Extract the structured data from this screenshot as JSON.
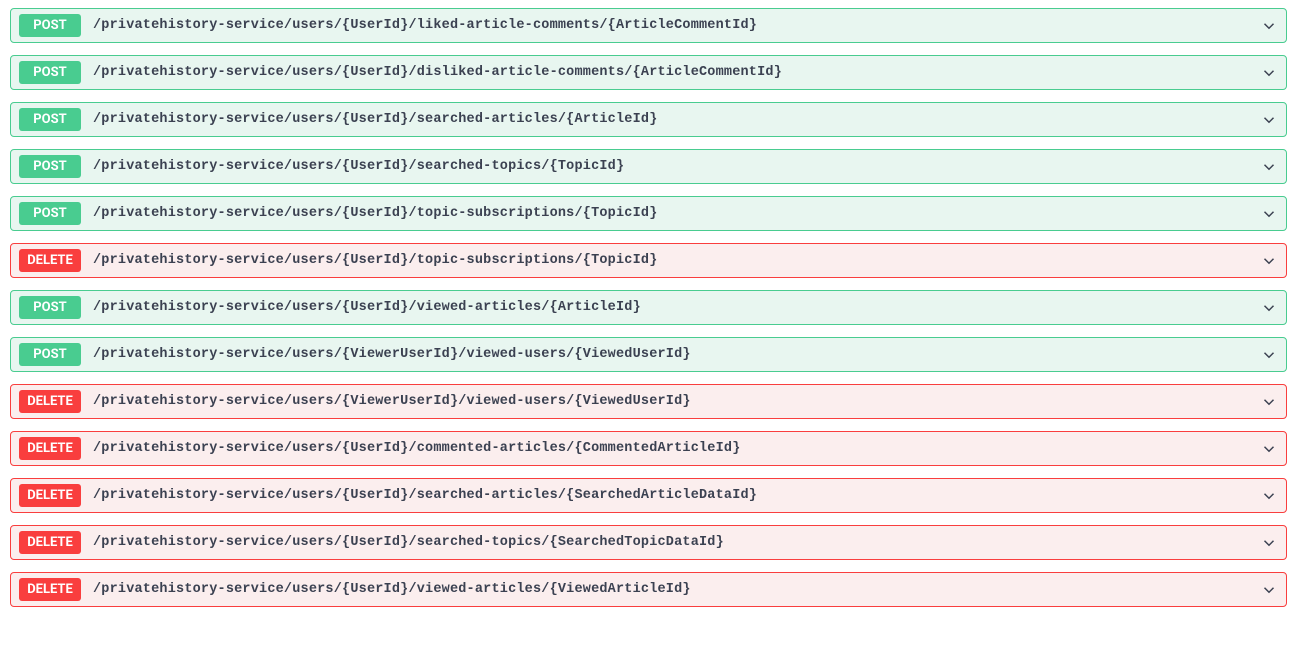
{
  "endpoints": [
    {
      "method": "POST",
      "path": "/privatehistory-service/users/{UserId}/liked-article-comments/{ArticleCommentId}"
    },
    {
      "method": "POST",
      "path": "/privatehistory-service/users/{UserId}/disliked-article-comments/{ArticleCommentId}"
    },
    {
      "method": "POST",
      "path": "/privatehistory-service/users/{UserId}/searched-articles/{ArticleId}"
    },
    {
      "method": "POST",
      "path": "/privatehistory-service/users/{UserId}/searched-topics/{TopicId}"
    },
    {
      "method": "POST",
      "path": "/privatehistory-service/users/{UserId}/topic-subscriptions/{TopicId}"
    },
    {
      "method": "DELETE",
      "path": "/privatehistory-service/users/{UserId}/topic-subscriptions/{TopicId}"
    },
    {
      "method": "POST",
      "path": "/privatehistory-service/users/{UserId}/viewed-articles/{ArticleId}"
    },
    {
      "method": "POST",
      "path": "/privatehistory-service/users/{ViewerUserId}/viewed-users/{ViewedUserId}"
    },
    {
      "method": "DELETE",
      "path": "/privatehistory-service/users/{ViewerUserId}/viewed-users/{ViewedUserId}"
    },
    {
      "method": "DELETE",
      "path": "/privatehistory-service/users/{UserId}/commented-articles/{CommentedArticleId}"
    },
    {
      "method": "DELETE",
      "path": "/privatehistory-service/users/{UserId}/searched-articles/{SearchedArticleDataId}"
    },
    {
      "method": "DELETE",
      "path": "/privatehistory-service/users/{UserId}/searched-topics/{SearchedTopicDataId}"
    },
    {
      "method": "DELETE",
      "path": "/privatehistory-service/users/{UserId}/viewed-articles/{ViewedArticleId}"
    }
  ]
}
